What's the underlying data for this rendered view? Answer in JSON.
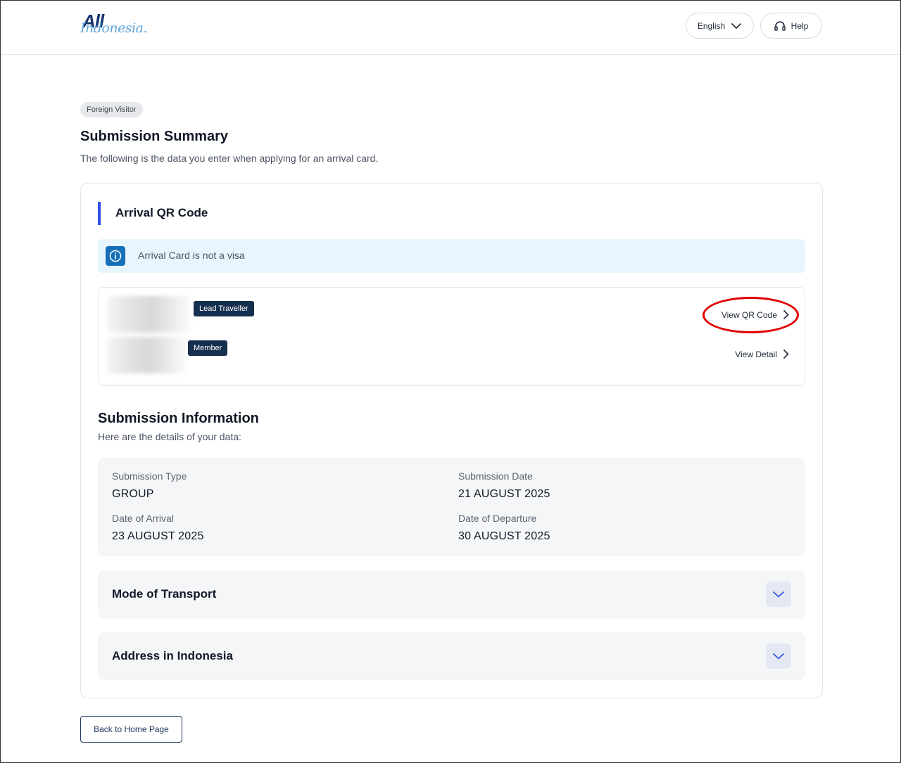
{
  "header": {
    "logo": {
      "line1": "All",
      "line2": "Indonesia."
    },
    "language_label": "English",
    "help_label": "Help"
  },
  "page": {
    "tag": "Foreign Visitor",
    "title": "Submission Summary",
    "subtitle": "The following is the data you enter when applying for an arrival card."
  },
  "qr_section": {
    "title": "Arrival QR Code",
    "notice": "Arrival Card is not a visa",
    "travellers": [
      {
        "badge": "Lead Traveller",
        "link": "View QR Code"
      },
      {
        "badge": "Member",
        "link": "View Detail"
      }
    ]
  },
  "info_section": {
    "title": "Submission Information",
    "subtitle": "Here are the details of your data:",
    "fields": {
      "submission_type": {
        "label": "Submission Type",
        "value": "GROUP"
      },
      "submission_date": {
        "label": "Submission Date",
        "value": "21 AUGUST 2025"
      },
      "date_of_arrival": {
        "label": "Date of Arrival",
        "value": "23 AUGUST 2025"
      },
      "date_of_departure": {
        "label": "Date of Departure",
        "value": "30 AUGUST 2025"
      }
    }
  },
  "accordions": [
    {
      "title": "Mode of Transport",
      "expanded": false
    },
    {
      "title": "Address in Indonesia",
      "expanded": false
    }
  ],
  "footer": {
    "back_label": "Back to Home Page"
  },
  "colors": {
    "accent_bar": "#2f4ee8",
    "badge_bg": "#15304f",
    "notice_bg": "#e6f6fc",
    "notice_icon_bg": "#1670b8",
    "highlight_circle": "#e00000"
  },
  "icons": {
    "language": "chevron-down-icon",
    "help": "headset-icon",
    "notice": "info-icon",
    "link": "chevron-right-icon",
    "accordion": "chevron-down-icon"
  }
}
